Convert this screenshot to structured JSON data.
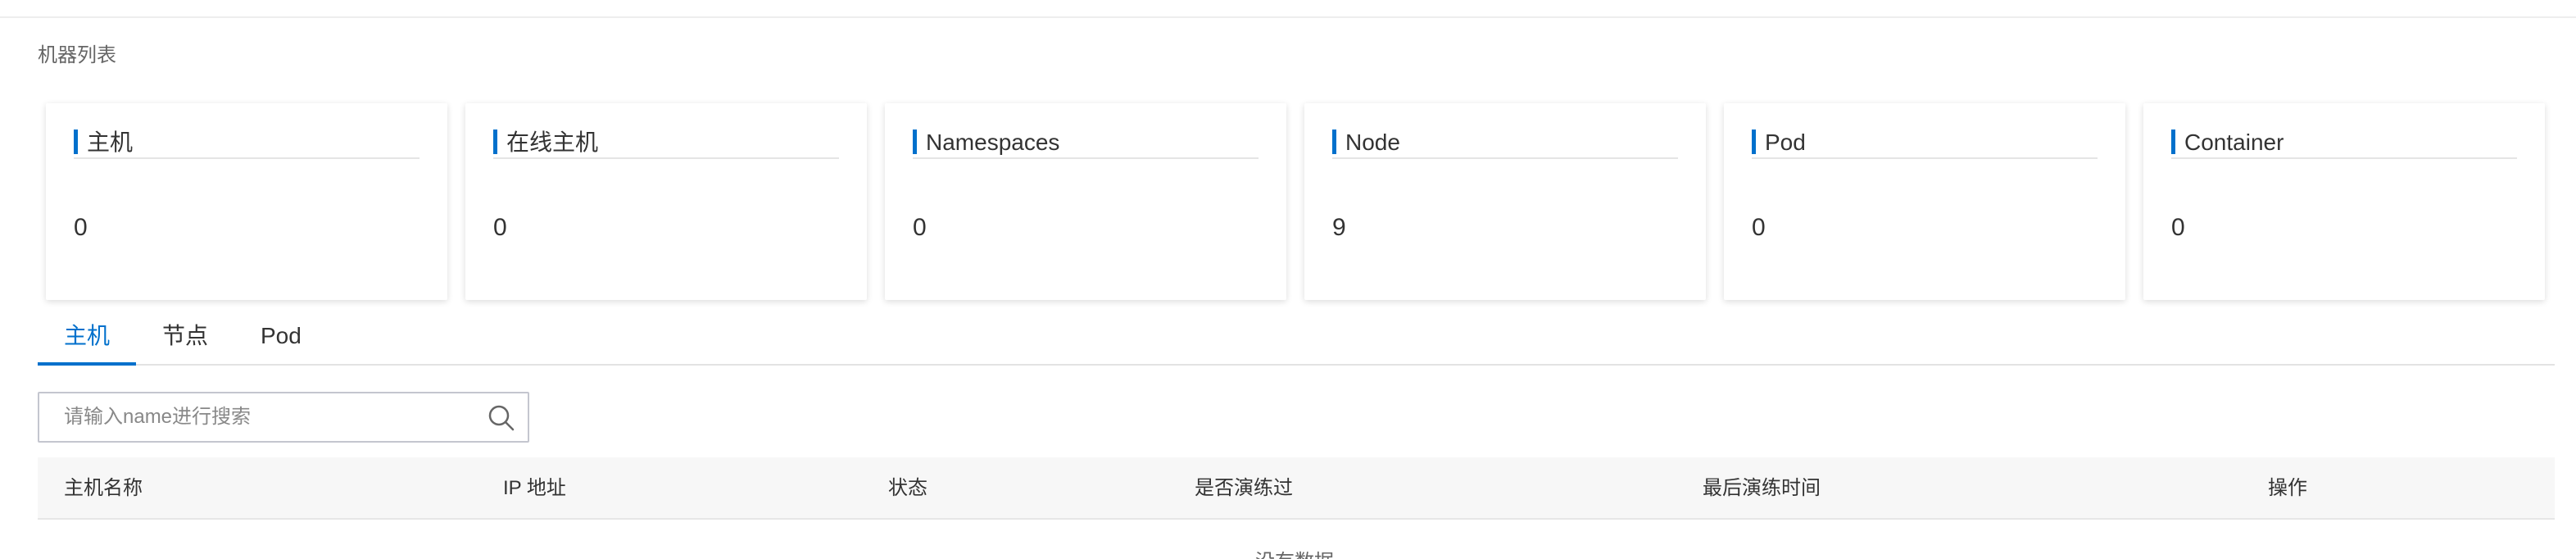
{
  "section": {
    "title": "机器列表"
  },
  "cards": [
    {
      "title": "主机",
      "value": "0"
    },
    {
      "title": "在线主机",
      "value": "0"
    },
    {
      "title": "Namespaces",
      "value": "0"
    },
    {
      "title": "Node",
      "value": "9"
    },
    {
      "title": "Pod",
      "value": "0"
    },
    {
      "title": "Container",
      "value": "0"
    }
  ],
  "tabs": [
    {
      "label": "主机",
      "active": true
    },
    {
      "label": "节点",
      "active": false
    },
    {
      "label": "Pod",
      "active": false
    }
  ],
  "search": {
    "placeholder": "请输入name进行搜索",
    "value": "",
    "icon": "search-icon"
  },
  "table": {
    "columns": [
      "主机名称",
      "IP 地址",
      "状态",
      "是否演练过",
      "最后演练时间",
      "操作"
    ],
    "rows": [],
    "empty_text": "没有数据"
  },
  "colors": {
    "accent": "#0070cc",
    "header_bg": "#f7f7f7"
  }
}
